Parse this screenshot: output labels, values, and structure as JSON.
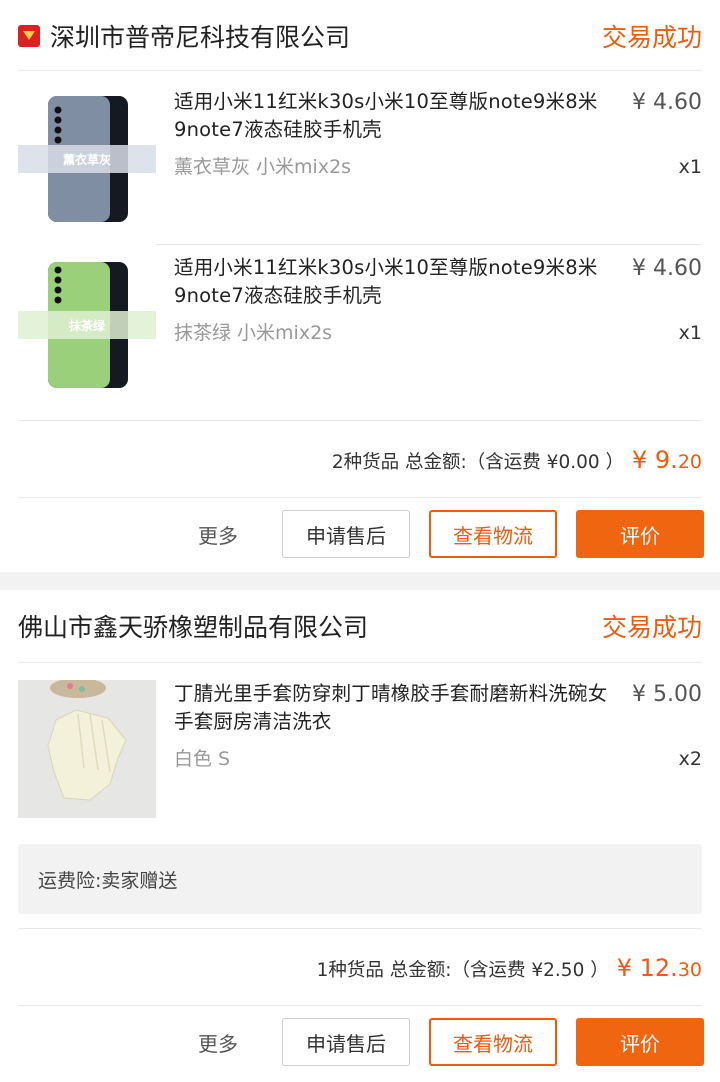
{
  "orders": [
    {
      "shop": "深圳市普帝尼科技有限公司",
      "status": "交易成功",
      "items": [
        {
          "title": "适用小米11红米k30s小米10至尊版note9米8米9note7液态硅胶手机壳",
          "price": "¥ 4.60",
          "spec": "薰衣草灰 小米mix2s",
          "qty": "x1",
          "thumb_label": "薰衣草灰",
          "thumb_color": "#7f8ea3"
        },
        {
          "title": "适用小米11红米k30s小米10至尊版note9米8米9note7液态硅胶手机壳",
          "price": "¥ 4.60",
          "spec": "抹茶绿 小米mix2s",
          "qty": "x1",
          "thumb_label": "抹茶绿",
          "thumb_color": "#9ad07a"
        }
      ],
      "summary_text": "2种货品 总金额:（含运费 ¥0.00 ）",
      "total_main": "¥ 9.",
      "total_cents": "20",
      "more_label": "更多",
      "after_sale_label": "申请售后",
      "logistics_label": "查看物流",
      "review_label": "评价"
    },
    {
      "shop": "佛山市鑫天骄橡塑制品有限公司",
      "status": "交易成功",
      "items": [
        {
          "title": "丁腈光里手套防穿刺丁晴橡胶手套耐磨新料洗碗女手套厨房清洁洗衣",
          "price": "¥ 5.00",
          "spec": "白色 S",
          "qty": "x2"
        }
      ],
      "insurance": "运费险:卖家赠送",
      "summary_text": "1种货品 总金额:（含运费 ¥2.50 ）",
      "total_main": "¥ 12.",
      "total_cents": "30",
      "more_label": "更多",
      "after_sale_label": "申请售后",
      "logistics_label": "查看物流",
      "review_label": "评价"
    }
  ],
  "colors": {
    "accent": "#f25a0c",
    "button_fill": "#f0650f",
    "separator": "#f2f2f2"
  }
}
